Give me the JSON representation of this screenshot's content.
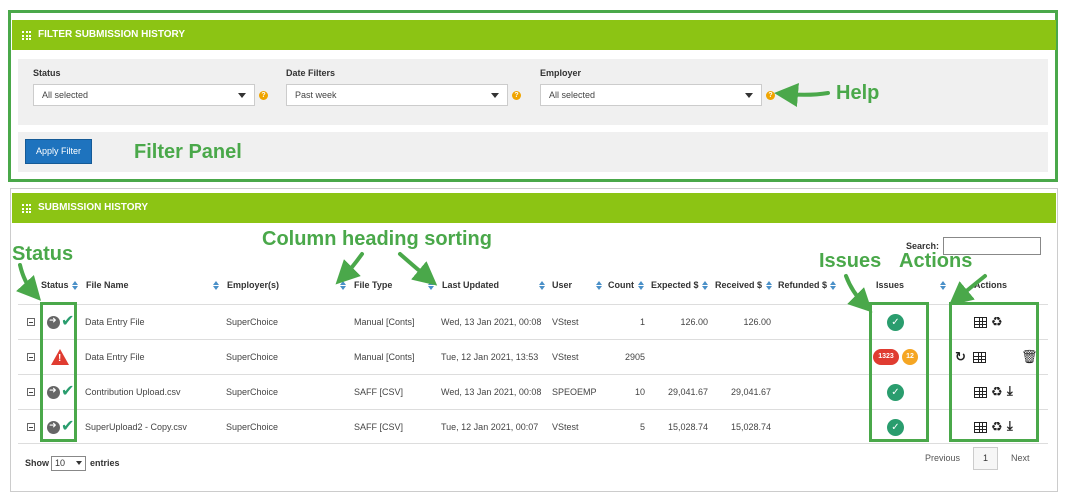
{
  "filter_panel": {
    "title": "FILTER SUBMISSION HISTORY",
    "status": {
      "label": "Status",
      "value": "All selected"
    },
    "date": {
      "label": "Date Filters",
      "value": "Past week"
    },
    "employer": {
      "label": "Employer",
      "value": "All selected"
    },
    "help_glyph": "?",
    "apply_label": "Apply Filter"
  },
  "history_panel": {
    "title": "SUBMISSION HISTORY",
    "search_label": "Search:",
    "columns": [
      "Status",
      "File Name",
      "Employer(s)",
      "File Type",
      "Last Updated",
      "User",
      "Count",
      "Expected $",
      "Received $",
      "Refunded $",
      "Issues",
      "Actions"
    ],
    "rows": [
      {
        "file_name": "Data Entry File",
        "employer": "SuperChoice",
        "file_type": "Manual [Conts]",
        "last_updated": "Wed, 13 Jan 2021, 00:08",
        "user": "VStest",
        "count": "1",
        "expected": "126.00",
        "received": "126.00",
        "refunded": "",
        "status": "ok"
      },
      {
        "file_name": "Data Entry File",
        "employer": "SuperChoice",
        "file_type": "Manual [Conts]",
        "last_updated": "Tue, 12 Jan 2021, 13:53",
        "user": "VStest",
        "count": "2905",
        "expected": "",
        "received": "",
        "refunded": "",
        "status": "warning",
        "issue_badges": [
          "1323",
          "12"
        ]
      },
      {
        "file_name": "Contribution Upload.csv",
        "employer": "SuperChoice",
        "file_type": "SAFF [CSV]",
        "last_updated": "Wed, 13 Jan 2021, 00:08",
        "user": "SPEOEMP",
        "count": "10",
        "expected": "29,041.67",
        "received": "29,041.67",
        "refunded": "",
        "status": "ok"
      },
      {
        "file_name": "SuperUpload2 - Copy.csv",
        "employer": "SuperChoice",
        "file_type": "SAFF [CSV]",
        "last_updated": "Tue, 12 Jan 2021, 00:07",
        "user": "VStest",
        "count": "5",
        "expected": "15,028.74",
        "received": "15,028.74",
        "refunded": "",
        "status": "ok"
      }
    ],
    "show_label": "Show",
    "entries_value": "10",
    "entries_label": "entries",
    "previous_label": "Previous",
    "page_number": "1",
    "next_label": "Next"
  },
  "annotations": {
    "help": "Help",
    "filter_panel": "Filter Panel",
    "status": "Status",
    "column_sorting": "Column heading sorting",
    "issues": "Issues",
    "actions": "Actions"
  },
  "colors": {
    "header_green": "#8cc414",
    "annotation_green": "#4aa84a",
    "button_blue": "#1e73be",
    "ok_green": "#2a9d6e",
    "badge_red": "#e03c31",
    "badge_orange": "#f5a623"
  }
}
